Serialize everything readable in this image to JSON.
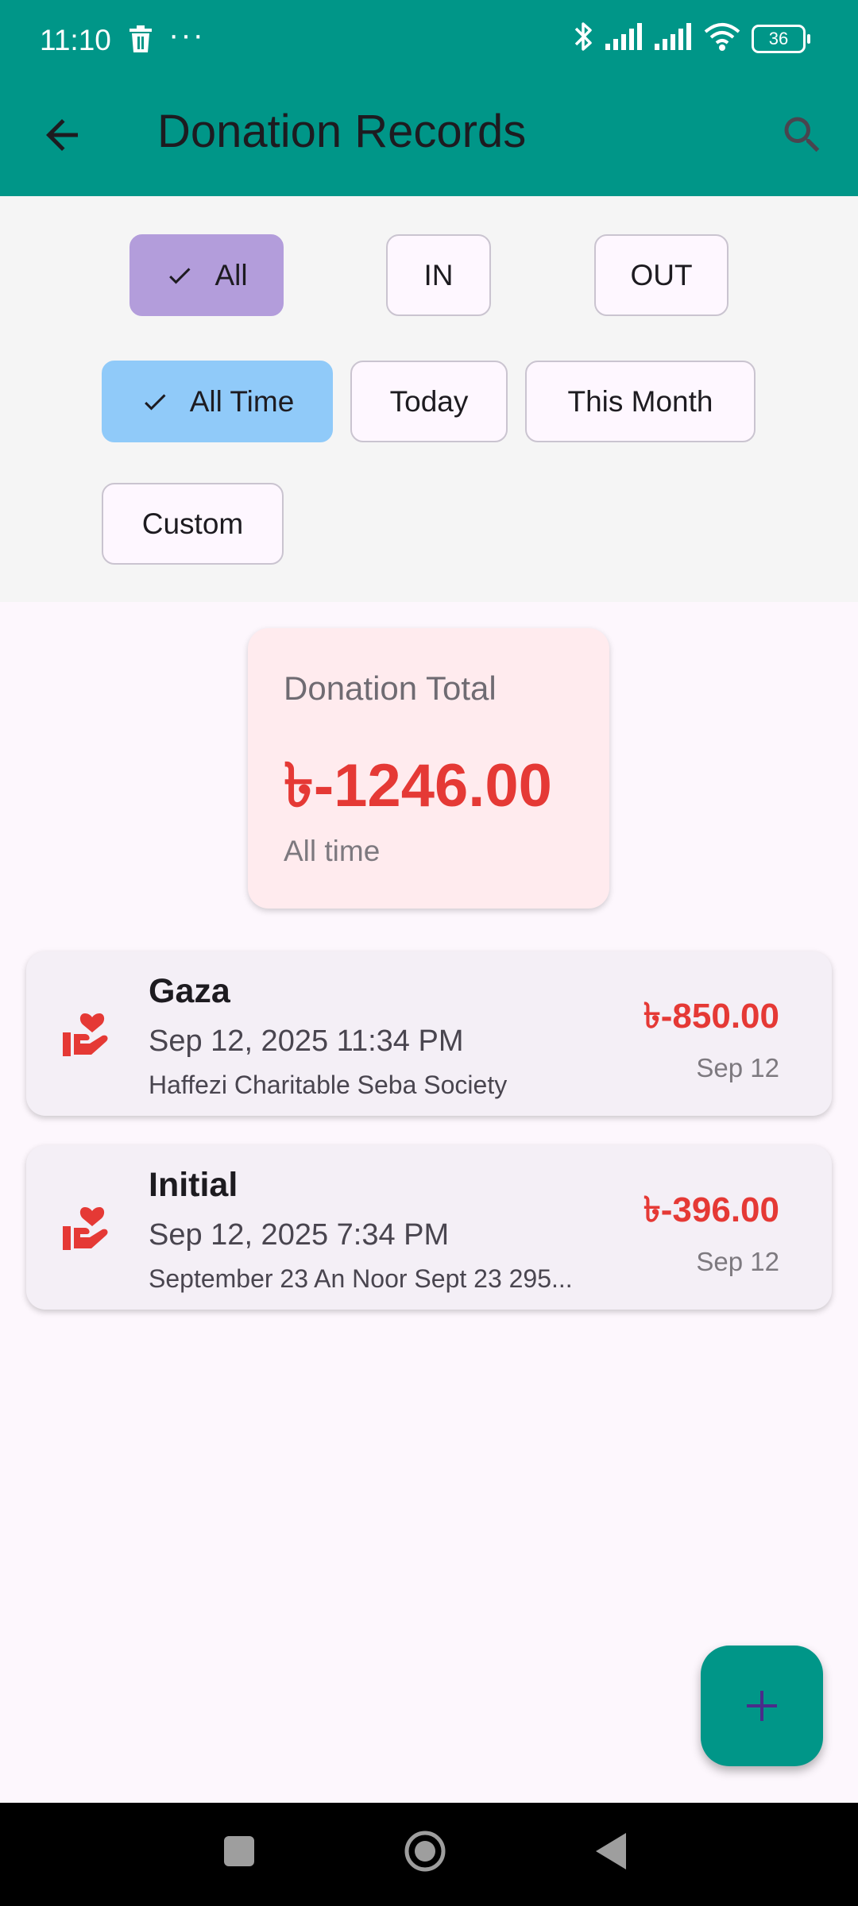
{
  "status_bar": {
    "time": "11:10",
    "dots": "···",
    "battery": "36"
  },
  "app_bar": {
    "title": "Donation Records"
  },
  "type_filters": [
    {
      "label": "All",
      "selected": true
    },
    {
      "label": "IN",
      "selected": false
    },
    {
      "label": "OUT",
      "selected": false
    }
  ],
  "time_filters": [
    {
      "label": "All Time",
      "selected": true
    },
    {
      "label": "Today",
      "selected": false
    },
    {
      "label": "This Month",
      "selected": false
    },
    {
      "label": "Custom",
      "selected": false
    }
  ],
  "summary": {
    "label": "Donation Total",
    "amount": "৳-1246.00",
    "period": "All time"
  },
  "records": [
    {
      "name": "Gaza",
      "datetime": "Sep 12, 2025 11:34 PM",
      "organization": "Haffezi Charitable Seba Society",
      "amount": "৳-850.00",
      "date": "Sep 12"
    },
    {
      "name": "Initial",
      "datetime": "Sep 12, 2025 7:34 PM",
      "organization": "September 23 An Noor Sept 23 295...",
      "amount": "৳-396.00",
      "date": "Sep 12"
    }
  ],
  "colors": {
    "app_bar": "#009688",
    "negative_amount": "#e53935",
    "chip_selected_type": "#b39ddb",
    "chip_selected_time": "#90caf9",
    "summary_card": "#ffebee"
  },
  "icons": {
    "back": "arrow-back-icon",
    "search": "search-icon",
    "record": "volunteer-activism-icon",
    "fab": "add-icon"
  }
}
